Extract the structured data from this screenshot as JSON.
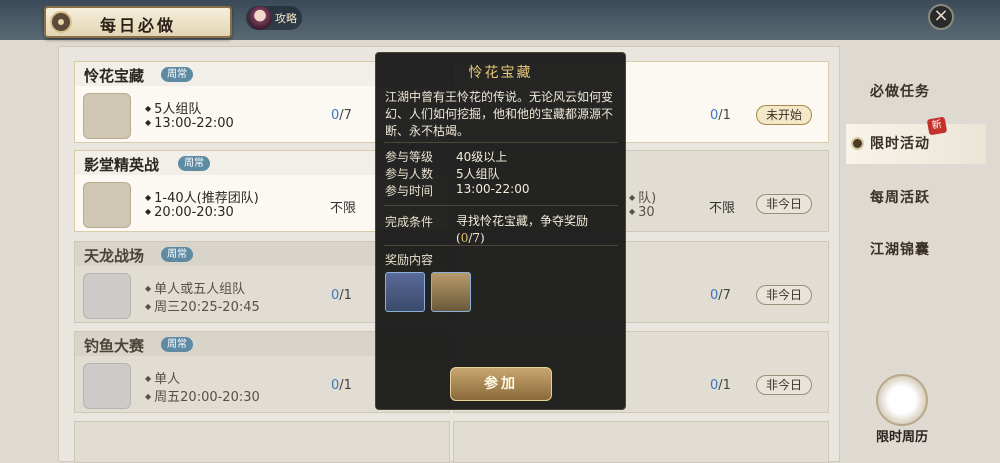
{
  "header": {
    "title": "每日必做",
    "strategy_label": "攻略",
    "close_icon": "close-icon"
  },
  "cards": [
    {
      "title": "怜花宝藏",
      "badge": "周常",
      "line1": "5人组队",
      "line2": "13:00-22:00",
      "count_cur": "0",
      "count_total": "/7"
    },
    {
      "title": "影堂精英战",
      "badge": "周常",
      "line1": "1-40人(推荐团队)",
      "line2": "20:00-20:30",
      "limit": "不限"
    },
    {
      "title": "天龙战场",
      "badge": "周常",
      "line1": "单人或五人组队",
      "line2": "周三20:25-20:45",
      "count_cur": "0",
      "count_total": "/1"
    },
    {
      "title": "钓鱼大赛",
      "badge": "周常",
      "line1": "单人",
      "line2": "周五20:00-20:30",
      "count_cur": "0",
      "count_total": "/1"
    }
  ],
  "right_cards": [
    {
      "count_cur": "0",
      "count_total": "/1",
      "status": "未开始"
    },
    {
      "fragment1": "队)",
      "fragment2": "30",
      "limit": "不限",
      "status": "非今日"
    },
    {
      "count_cur": "0",
      "count_total": "/7",
      "status": "非今日"
    },
    {
      "count_cur": "0",
      "count_total": "/1",
      "status": "非今日"
    }
  ],
  "tabs": [
    "必做任务",
    "限时活动",
    "每周活跃",
    "江湖锦囊"
  ],
  "new_badge": "新",
  "calendar_label": "限时周历",
  "popup": {
    "title": "怜花宝藏",
    "description": "江湖中曾有王怜花的传说。无论风云如何变幻、人们如何挖掘，他和他的宝藏都源源不断、永不枯竭。",
    "level_label": "参与等级",
    "level_value": "40级以上",
    "people_label": "参与人数",
    "people_value": "5人组队",
    "time_label": "参与时间",
    "time_value": "13:00-22:00",
    "goal_label": "完成条件",
    "goal_text": "寻找怜花宝藏，争夺奖励",
    "goal_open": "(",
    "goal_cur": "0",
    "goal_total": "/7)",
    "reward_label": "奖励内容",
    "join_label": "参加"
  }
}
